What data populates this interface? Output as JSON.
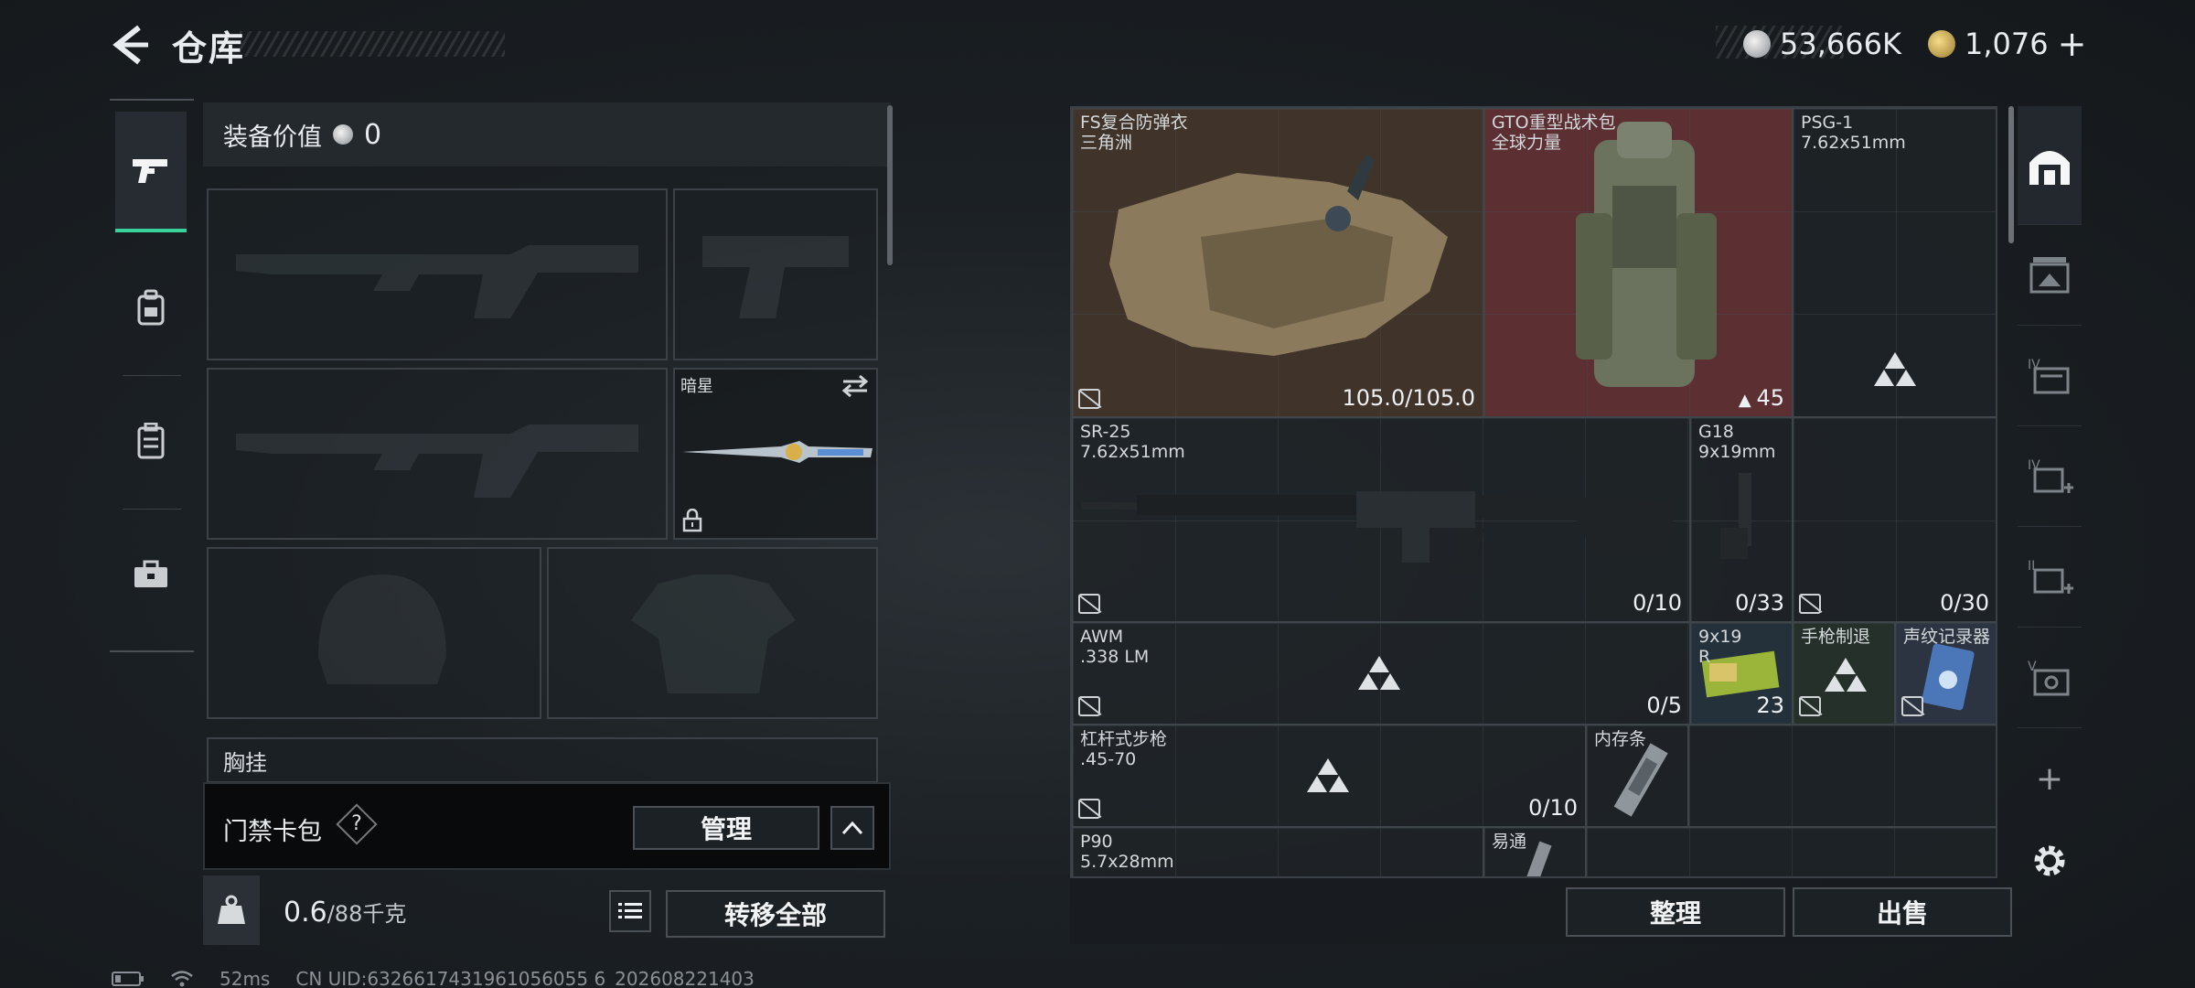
{
  "header": {
    "title": "仓库",
    "currencies": [
      {
        "icon": "silver-coin-icon",
        "value": "53,666K"
      },
      {
        "icon": "gold-coin-icon",
        "value": "1,076"
      }
    ],
    "add_label": "+"
  },
  "sidebar": {
    "tabs": [
      {
        "name": "pistol-icon",
        "active": true
      },
      {
        "name": "backpack-icon",
        "active": false
      },
      {
        "name": "vest-icon",
        "active": false
      },
      {
        "name": "case-icon",
        "active": false
      }
    ]
  },
  "equipment": {
    "value_label": "装备价值",
    "value": "0",
    "melee_label": "暗星",
    "chest_label": "胸挂",
    "card_label": "门禁卡包",
    "card_help": "?",
    "manage_label": "管理",
    "weight": "0.6",
    "weight_max": "/88千克",
    "weight_badge": "KG",
    "transfer_label": "转移全部"
  },
  "inventory": {
    "items": [
      {
        "name": "FS复合防弹衣",
        "sub": "三角洲",
        "value": "105.0/105.0"
      },
      {
        "name": "GTO重型战术包",
        "sub": "全球力量",
        "value": "45"
      },
      {
        "name": "PSG-1",
        "sub": "7.62x51mm",
        "value": ""
      },
      {
        "name": "SR-25",
        "sub": "7.62x51mm",
        "value": "0/10"
      },
      {
        "name": "G18",
        "sub": "9x19mm",
        "value": "0/33"
      },
      {
        "name": "",
        "sub": "",
        "value": "0/30"
      },
      {
        "name": "AWM",
        "sub": ".338 LM",
        "value": "0/5"
      },
      {
        "name": "9x19",
        "sub": "R",
        "value": "23"
      },
      {
        "name": "手枪制退",
        "sub": "",
        "value": ""
      },
      {
        "name": "声纹记录器",
        "sub": "",
        "value": ""
      },
      {
        "name": "杠杆式步枪",
        "sub": ".45-70",
        "value": "0/10"
      },
      {
        "name": "内存条",
        "sub": "",
        "value": ""
      },
      {
        "name": "P90",
        "sub": "5.7x28mm",
        "value": ""
      },
      {
        "name": "易通",
        "sub": "",
        "value": ""
      }
    ],
    "sort_label": "整理",
    "sell_label": "出售"
  },
  "rail": {
    "add_label": "+"
  },
  "status": {
    "ping": "52ms",
    "uid": "CN UID:6326617431961056055 6_202608221403"
  }
}
